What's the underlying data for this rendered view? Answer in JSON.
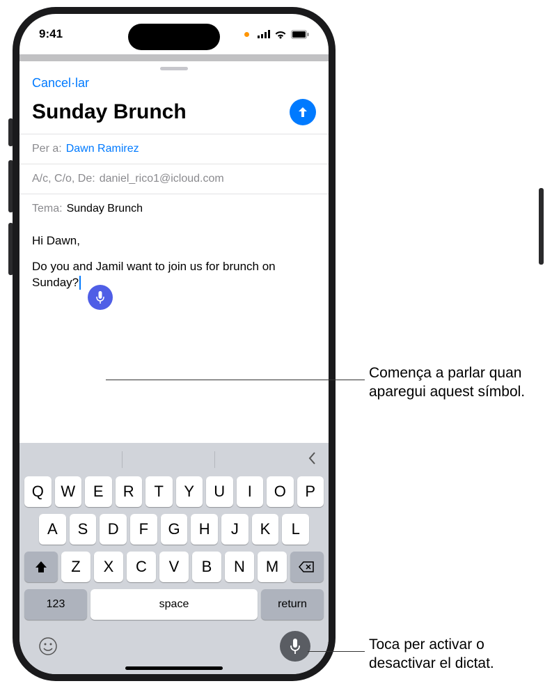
{
  "status": {
    "time": "9:41"
  },
  "compose": {
    "cancel": "Cancel·lar",
    "title": "Sunday Brunch",
    "to_label": "Per a:",
    "to_value": "Dawn Ramirez",
    "cc_label": "A/c, C/o, De:",
    "cc_value": "daniel_rico1@icloud.com",
    "subject_label": "Tema:",
    "subject_value": "Sunday Brunch",
    "body_line1": "Hi Dawn,",
    "body_line2": "Do you and Jamil want to join us for brunch on Sunday?"
  },
  "keyboard": {
    "row1": [
      "Q",
      "W",
      "E",
      "R",
      "T",
      "Y",
      "U",
      "I",
      "O",
      "P"
    ],
    "row2": [
      "A",
      "S",
      "D",
      "F",
      "G",
      "H",
      "J",
      "K",
      "L"
    ],
    "row3": [
      "Z",
      "X",
      "C",
      "V",
      "B",
      "N",
      "M"
    ],
    "numeric": "123",
    "space": "space",
    "return": "return"
  },
  "callouts": {
    "c1": "Comença a parlar quan aparegui aquest símbol.",
    "c2": "Toca per activar o desactivar el dictat."
  }
}
